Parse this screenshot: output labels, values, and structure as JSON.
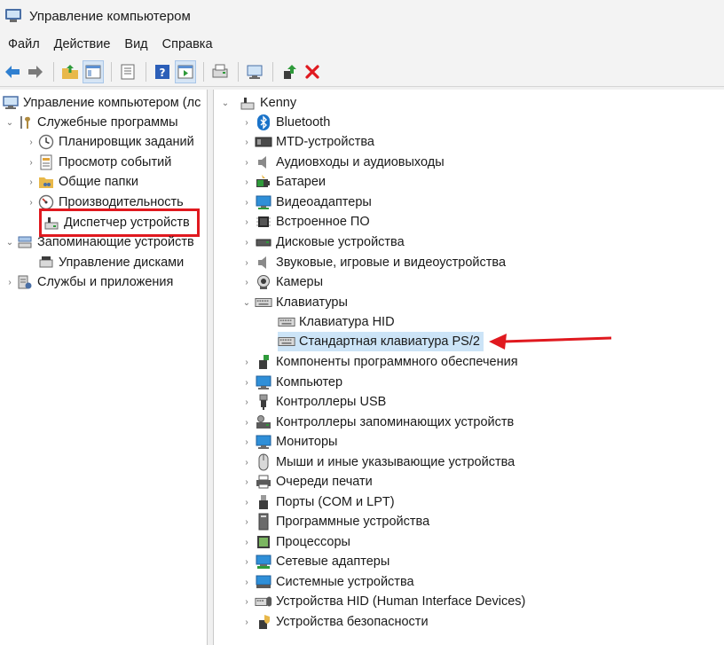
{
  "window": {
    "title": "Управление компьютером"
  },
  "menu": [
    "Файл",
    "Действие",
    "Вид",
    "Справка"
  ],
  "toolbar": {
    "buttons": [
      "back-icon",
      "forward-icon",
      "up-folder-icon",
      "show-tree-icon",
      "properties-icon",
      "help-icon",
      "action-pane-icon",
      "scan-hardware-icon",
      "update-driver-icon",
      "enable-device-icon",
      "uninstall-icon"
    ]
  },
  "left_tree": {
    "root": "Управление компьютером (лс",
    "system_tools": "Служебные программы",
    "task_scheduler": "Планировщик заданий",
    "event_viewer": "Просмотр событий",
    "shared_folders": "Общие папки",
    "performance": "Производительность",
    "device_manager": "Диспетчер устройств",
    "storage": "Запоминающие устройств",
    "disk_management": "Управление дисками",
    "services": "Службы и приложения"
  },
  "device_tree": {
    "computer": "Kenny",
    "categories": [
      "Bluetooth",
      "MTD-устройства",
      "Аудиовходы и аудиовыходы",
      "Батареи",
      "Видеоадаптеры",
      "Встроенное ПО",
      "Дисковые устройства",
      "Звуковые, игровые и видеоустройства",
      "Камеры",
      "Клавиатуры"
    ],
    "keyboards": [
      "Клавиатура HID",
      "Стандартная клавиатура PS/2"
    ],
    "categories_after": [
      "Компоненты программного обеспечения",
      "Компьютер",
      "Контроллеры USB",
      "Контроллеры запоминающих устройств",
      "Мониторы",
      "Мыши и иные указывающие устройства",
      "Очереди печати",
      "Порты (COM и LPT)",
      "Программные устройства",
      "Процессоры",
      "Сетевые адаптеры",
      "Системные устройства",
      "Устройства HID (Human Interface Devices)",
      "Устройства безопасности"
    ]
  },
  "colors": {
    "highlight_red": "#e0191f",
    "selection_blue": "#cce4f7",
    "accent": "#1a73c9"
  }
}
